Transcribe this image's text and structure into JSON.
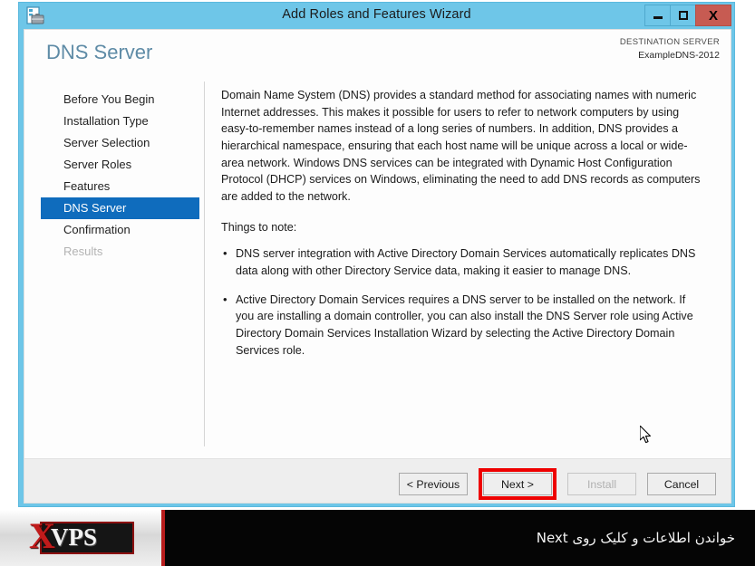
{
  "window": {
    "title": "Add Roles and Features Wizard",
    "app_icon": "server-manager-icon",
    "controls": {
      "minimize": "minimize-icon",
      "maximize": "maximize-icon",
      "close": "X"
    }
  },
  "header": {
    "page_title": "DNS Server",
    "destination_label": "DESTINATION SERVER",
    "destination_value": "ExampleDNS-2012"
  },
  "sidebar": {
    "items": [
      {
        "label": "Before You Begin",
        "state": "normal"
      },
      {
        "label": "Installation Type",
        "state": "normal"
      },
      {
        "label": "Server Selection",
        "state": "normal"
      },
      {
        "label": "Server Roles",
        "state": "normal"
      },
      {
        "label": "Features",
        "state": "normal"
      },
      {
        "label": "DNS Server",
        "state": "selected"
      },
      {
        "label": "Confirmation",
        "state": "normal"
      },
      {
        "label": "Results",
        "state": "disabled"
      }
    ]
  },
  "content": {
    "intro_paragraph": "Domain Name System (DNS) provides a standard method for associating names with numeric Internet addresses. This makes it possible for users to refer to network computers by using easy-to-remember names instead of a long series of numbers. In addition, DNS provides a hierarchical namespace, ensuring that each host name will be unique across a local or wide-area network. Windows DNS services can be integrated with Dynamic Host Configuration Protocol (DHCP) services on Windows, eliminating the need to add DNS records as computers are added to the network.",
    "note_heading": "Things to note:",
    "bullet_glyph": "•",
    "notes": [
      "DNS server integration with Active Directory Domain Services automatically replicates DNS data along with other Directory Service data, making it easier to manage DNS.",
      "Active Directory Domain Services requires a DNS server to be installed on the network. If you are installing a domain controller, you can also install the DNS Server role using Active Directory Domain Services Installation Wizard by selecting the Active Directory Domain Services role."
    ]
  },
  "footer": {
    "previous_label": "< Previous",
    "next_label": "Next >",
    "install_label": "Install",
    "cancel_label": "Cancel"
  },
  "annotation": {
    "highlight_color": "#ee0000",
    "highlight_target": "Next >"
  },
  "banner": {
    "logo_x": "X",
    "logo_vps": "VPS",
    "instruction": "خواندن اطلاعات و کلیک روی Next"
  },
  "colors": {
    "titlebar": "#6ec6e8",
    "close_button": "#c75b52",
    "selection": "#0f6cbd",
    "page_title": "#5e8ba6",
    "footer": "#eeeeee",
    "banner_bg": "#050505",
    "banner_accent": "#b81d1d"
  }
}
